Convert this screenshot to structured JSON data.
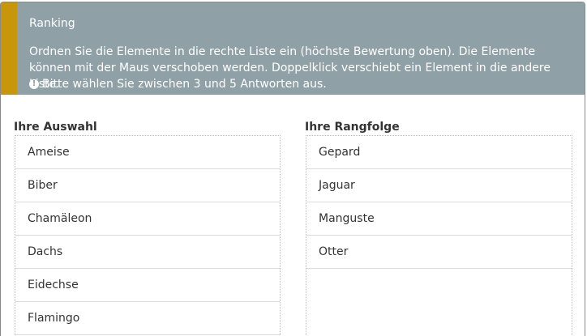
{
  "question": {
    "title": "Ranking",
    "text": "Ordnen Sie die Elemente in die rechte Liste ein (höchste Bewertung oben). Die Elemente können mit der Maus verschoben werden. Doppelklick verschiebt ein Element in die andere Liste.",
    "hint": "Bitte wählen Sie zwischen 3 und 5 Antworten aus.",
    "hint_icon": "exclamation-circle-icon"
  },
  "choices": {
    "label": "Ihre Auswahl",
    "items": [
      "Ameise",
      "Biber",
      "Chamäleon",
      "Dachs",
      "Eidechse",
      "Flamingo"
    ]
  },
  "ranking": {
    "label": "Ihre Rangfolge",
    "items": [
      "Gepard",
      "Jaguar",
      "Manguste",
      "Otter"
    ]
  },
  "colors": {
    "header_bg": "#8fa0a6",
    "accent": "#c8960a"
  }
}
